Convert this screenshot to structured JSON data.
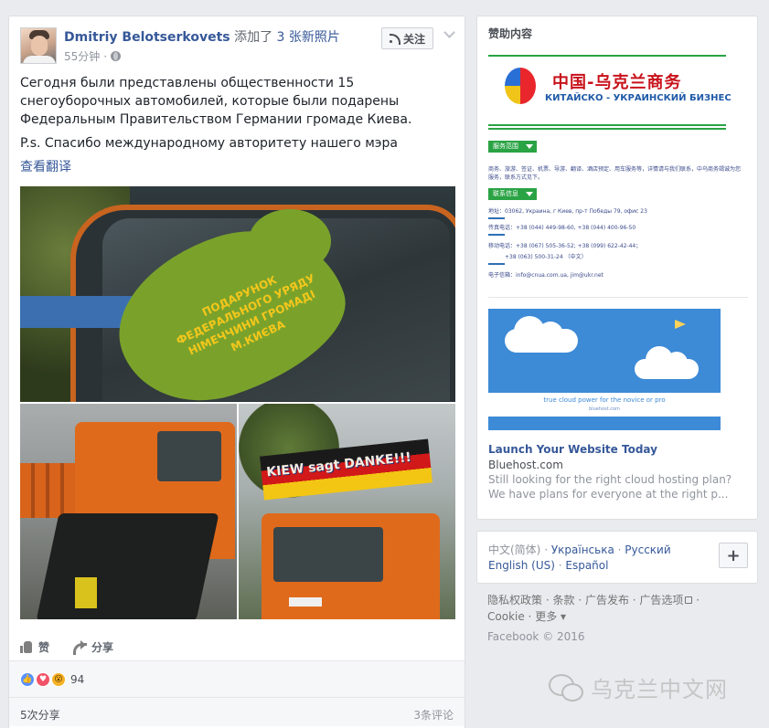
{
  "post": {
    "author": "Dmitriy Belotserkovets",
    "action_prefix": "添加了",
    "action_link": "3 张新照片",
    "time": "55分钟",
    "time_sep": "·",
    "follow_label": "关注",
    "text_lines": [
      "Сегодня были представлены общественности 15 снегоуборочных автомобилей, которые были подарены Федеральным Правительством Германии громаде Киева.",
      "P.s. Спасибо международному авторитету нашего мэра"
    ],
    "translate_label": "查看翻译",
    "photos": {
      "main_sticker": "ПОДАРУНОК ФЕДЕРАЛЬНОГО УРЯДУ НІМЕЧЧИНИ ГРОМАДІ М.КИЄВА",
      "banner": "KIEW sagt DANKE!!!"
    },
    "actions": {
      "like": "赞",
      "share": "分享"
    },
    "reactions": {
      "count": "94",
      "like_glyph": "👍",
      "love_glyph": "♥",
      "wow_glyph": "😮"
    },
    "footer": {
      "shares": "5次分享",
      "comments": "3条评论"
    }
  },
  "sidebar": {
    "sponsored_title": "赞助内容",
    "ad1": {
      "cn_title": "中国-乌克兰商务",
      "ru_title": "КИТАЙСКО - УКРАИНСКИЙ БИЗНЕС",
      "tag_services": "服务范围",
      "services_text_1": "商务、旅游、签证、机票、导游、翻译、酒店预定、用车服务等，详情请与我们联系，中乌商务竭诚为您",
      "services_text_2": "服务，联系方式见下。",
      "tag_contact": "联系信息",
      "address": "地址：03062, Украина, г Киев, пр-т Победы 79, офис 23",
      "fax": "传真电话：+38 (044) 449-98-60, +38 (044) 400-96-50",
      "mobile": "移动电话：+38 (067) 505-36-52; +38 (099) 622-42-44；",
      "mobile2": "+38 (063) 500-31-24 （中文）",
      "email": "电子信箱：info@cnua.com.ua, jim@ukr.net"
    },
    "ad2": {
      "tagline": "true cloud power for the novice or pro",
      "image_domain": "bluehost.com",
      "title": "Launch Your Website Today",
      "domain": "Bluehost.com",
      "description": "Still looking for the right cloud hosting plan? We have plans for everyone at the right p..."
    },
    "languages": [
      {
        "label": "中文(简体)",
        "current": true
      },
      {
        "label": "Українська",
        "current": false
      },
      {
        "label": "Русский",
        "current": false
      },
      {
        "label": "English (US)",
        "current": false
      },
      {
        "label": "Español",
        "current": false
      }
    ],
    "lang_sep": " · ",
    "plus_label": "+",
    "footer_links": [
      "隐私权政策",
      "条款",
      "广告发布",
      "广告选项",
      "Cookie",
      "更多"
    ],
    "copyright": "Facebook © 2016"
  },
  "watermark": "乌克兰中文网"
}
